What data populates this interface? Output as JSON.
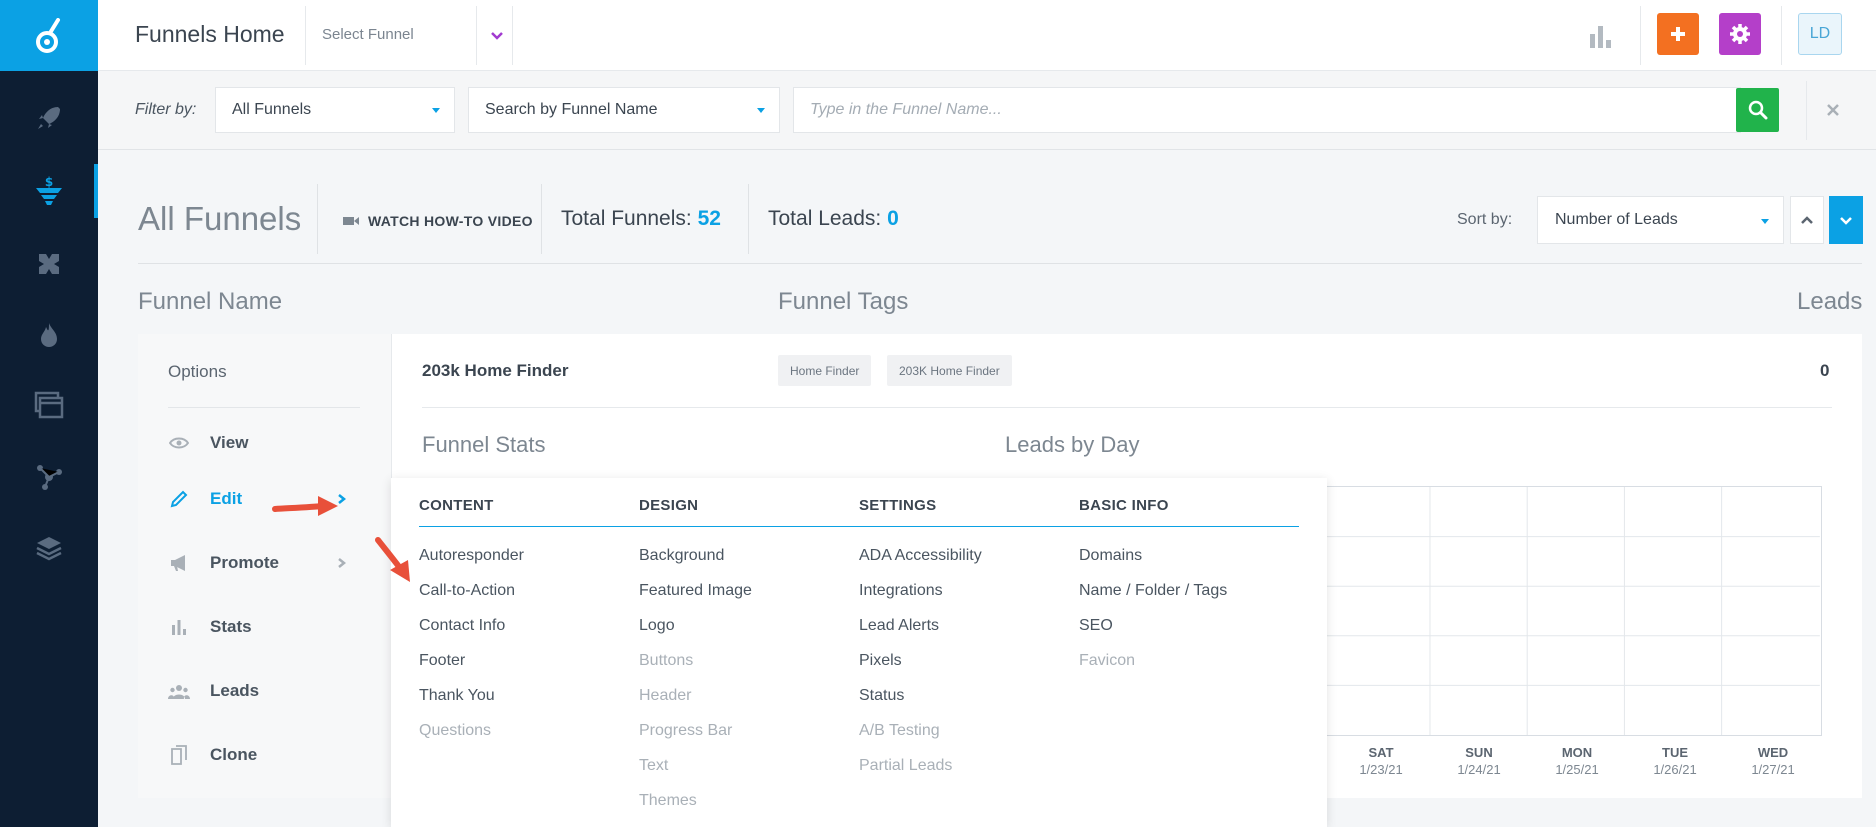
{
  "app": {
    "title": "Funnels Home",
    "select_funnel": "Select Funnel",
    "avatar": "LD"
  },
  "sidebar": {
    "items": [
      {
        "icon": "rocket-icon"
      },
      {
        "icon": "funnel-icon",
        "active": true
      },
      {
        "icon": "puzzle-icon"
      },
      {
        "icon": "fire-icon"
      },
      {
        "icon": "window-icon"
      },
      {
        "icon": "network-icon"
      },
      {
        "icon": "layers-icon"
      }
    ]
  },
  "filter": {
    "label": "Filter by:",
    "type_value": "All Funnels",
    "search_mode": "Search by Funnel Name",
    "input_placeholder": "Type in the Funnel Name..."
  },
  "header": {
    "title": "All Funnels",
    "watch_video": "WATCH HOW-TO VIDEO",
    "total_funnels_label": "Total Funnels:",
    "total_funnels_value": "52",
    "total_leads_label": "Total Leads:",
    "total_leads_value": "0",
    "sort_label": "Sort by:",
    "sort_value": "Number of Leads"
  },
  "columns": {
    "name": "Funnel Name",
    "tags": "Funnel Tags",
    "leads": "Leads"
  },
  "funnel": {
    "name": "203k Home Finder",
    "tags": [
      "Home Finder",
      "203K Home Finder"
    ],
    "leads": "0",
    "stats_title": "Funnel Stats",
    "leads_by_day_title": "Leads by Day"
  },
  "options": {
    "title": "Options",
    "items": [
      "View",
      "Edit",
      "Promote",
      "Stats",
      "Leads",
      "Clone"
    ]
  },
  "chart_data": {
    "type": "bar",
    "title": "Leads by Day",
    "categories": [
      "SAT 1/23/21",
      "SUN 1/24/21",
      "MON 1/25/21",
      "TUE 1/26/21",
      "WED 1/27/21"
    ],
    "values": [
      0,
      0,
      0,
      0,
      0
    ],
    "grid": true
  },
  "days": [
    {
      "day": "SAT",
      "date": "1/23/21"
    },
    {
      "day": "SUN",
      "date": "1/24/21"
    },
    {
      "day": "MON",
      "date": "1/25/21"
    },
    {
      "day": "TUE",
      "date": "1/26/21"
    },
    {
      "day": "WED",
      "date": "1/27/21"
    }
  ],
  "edit_menu": {
    "columns": [
      {
        "heading": "CONTENT",
        "items": [
          {
            "label": "Autoresponder",
            "enabled": true
          },
          {
            "label": "Call-to-Action",
            "enabled": true
          },
          {
            "label": "Contact Info",
            "enabled": true
          },
          {
            "label": "Footer",
            "enabled": true
          },
          {
            "label": "Thank You",
            "enabled": true
          },
          {
            "label": "Questions",
            "enabled": false
          }
        ]
      },
      {
        "heading": "DESIGN",
        "items": [
          {
            "label": "Background",
            "enabled": true
          },
          {
            "label": "Featured Image",
            "enabled": true
          },
          {
            "label": "Logo",
            "enabled": true
          },
          {
            "label": "Buttons",
            "enabled": false
          },
          {
            "label": "Header",
            "enabled": false
          },
          {
            "label": "Progress Bar",
            "enabled": false
          },
          {
            "label": "Text",
            "enabled": false
          },
          {
            "label": "Themes",
            "enabled": false
          }
        ]
      },
      {
        "heading": "SETTINGS",
        "items": [
          {
            "label": "ADA Accessibility",
            "enabled": true
          },
          {
            "label": "Integrations",
            "enabled": true
          },
          {
            "label": "Lead Alerts",
            "enabled": true
          },
          {
            "label": "Pixels",
            "enabled": true
          },
          {
            "label": "Status",
            "enabled": true
          },
          {
            "label": "A/B Testing",
            "enabled": false
          },
          {
            "label": "Partial Leads",
            "enabled": false
          }
        ]
      },
      {
        "heading": "BASIC INFO",
        "items": [
          {
            "label": "Domains",
            "enabled": true
          },
          {
            "label": "Name / Folder / Tags",
            "enabled": true
          },
          {
            "label": "SEO",
            "enabled": true
          },
          {
            "label": "Favicon",
            "enabled": false
          }
        ]
      }
    ]
  },
  "colors": {
    "accent": "#0ba1e4",
    "sidebar": "#0d1e33",
    "add_button": "#f37021",
    "settings_button": "#b43fc9",
    "search_button": "#21b34b",
    "annotation_arrow": "#e8503a"
  }
}
